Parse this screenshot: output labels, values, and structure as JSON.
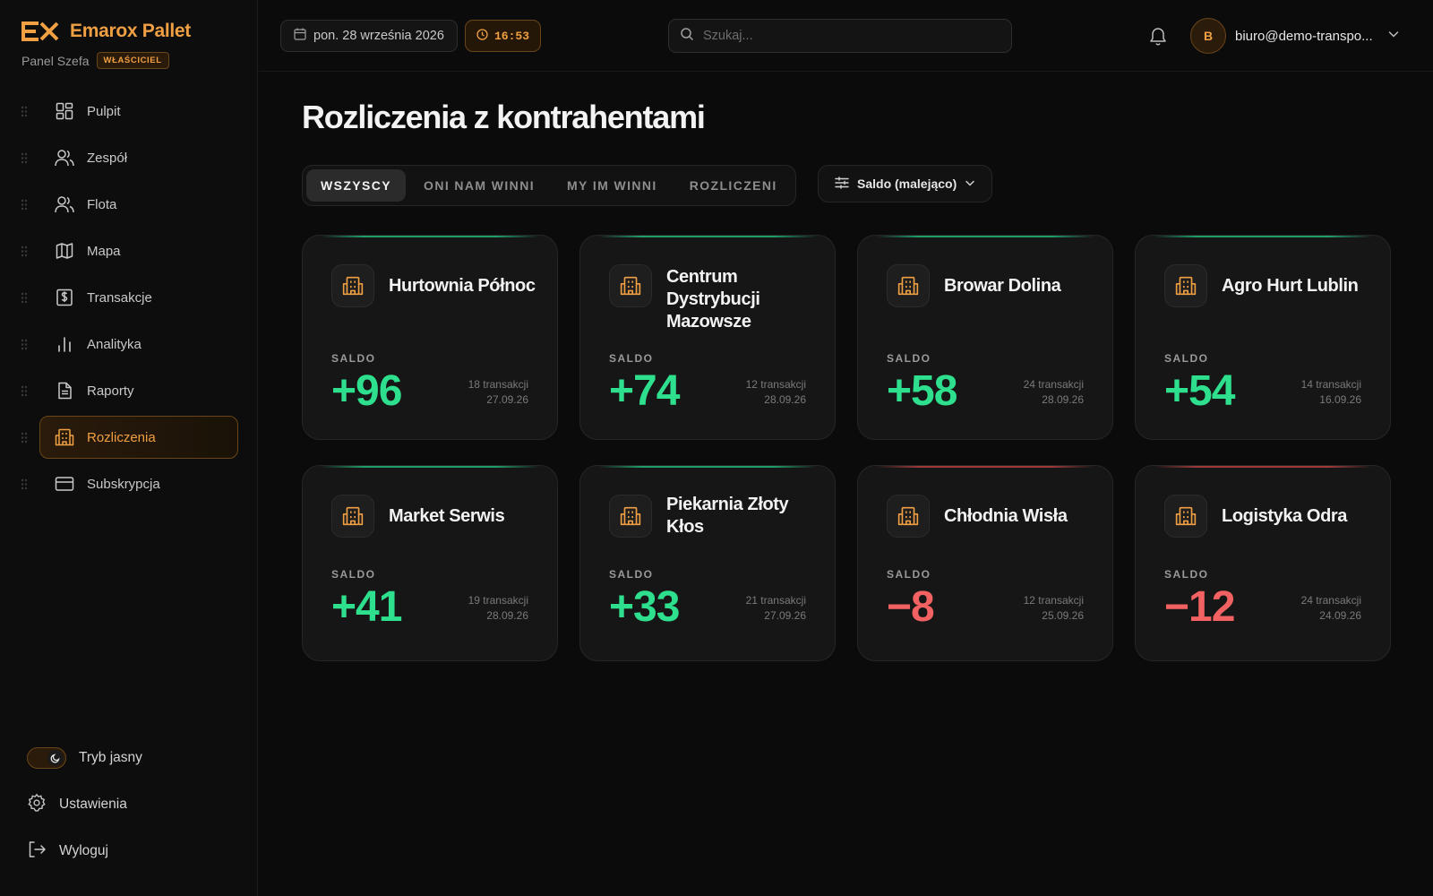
{
  "brand": {
    "name": "Emarox Pallet",
    "subtitle": "Panel Szefa",
    "role": "WŁAŚCICIEL",
    "accent": "#f0a043"
  },
  "sidebar": {
    "items": [
      {
        "label": "Pulpit",
        "icon": "dashboard-icon"
      },
      {
        "label": "Zespół",
        "icon": "users-icon"
      },
      {
        "label": "Flota",
        "icon": "users-icon"
      },
      {
        "label": "Mapa",
        "icon": "map-icon"
      },
      {
        "label": "Transakcje",
        "icon": "dollar-receipt-icon"
      },
      {
        "label": "Analityka",
        "icon": "bar-chart-icon"
      },
      {
        "label": "Raporty",
        "icon": "document-icon"
      },
      {
        "label": "Rozliczenia",
        "icon": "building-icon",
        "active": true
      },
      {
        "label": "Subskrypcja",
        "icon": "credit-card-icon"
      }
    ],
    "bottom": {
      "theme_label": "Tryb jasny",
      "settings_label": "Ustawienia",
      "logout_label": "Wyloguj"
    }
  },
  "topbar": {
    "date": "pon. 28 września 2026",
    "time": "16:53",
    "search_placeholder": "Szukaj...",
    "user_initial": "B",
    "user_email": "biuro@demo-transpo..."
  },
  "page": {
    "title": "Rozliczenia z kontrahentami",
    "tabs": [
      "WSZYSCY",
      "ONI NAM WINNI",
      "MY IM WINNI",
      "ROZLICZENI"
    ],
    "active_tab": "WSZYSCY",
    "sort_label": "Saldo (malejąco)"
  },
  "cards": [
    {
      "name": "Hurtownia Północ",
      "label": "SALDO",
      "value": "+96",
      "transactions": "18 transakcji",
      "date": "27.09.26",
      "sign": "pos"
    },
    {
      "name": "Centrum Dystrybucji Mazowsze",
      "label": "SALDO",
      "value": "+74",
      "transactions": "12 transakcji",
      "date": "28.09.26",
      "sign": "pos"
    },
    {
      "name": "Browar Dolina",
      "label": "SALDO",
      "value": "+58",
      "transactions": "24 transakcji",
      "date": "28.09.26",
      "sign": "pos"
    },
    {
      "name": "Agro Hurt Lublin",
      "label": "SALDO",
      "value": "+54",
      "transactions": "14 transakcji",
      "date": "16.09.26",
      "sign": "pos"
    },
    {
      "name": "Market Serwis",
      "label": "SALDO",
      "value": "+41",
      "transactions": "19 transakcji",
      "date": "28.09.26",
      "sign": "pos"
    },
    {
      "name": "Piekarnia Złoty Kłos",
      "label": "SALDO",
      "value": "+33",
      "transactions": "21 transakcji",
      "date": "27.09.26",
      "sign": "pos"
    },
    {
      "name": "Chłodnia Wisła",
      "label": "SALDO",
      "value": "−8",
      "transactions": "12 transakcji",
      "date": "25.09.26",
      "sign": "neg"
    },
    {
      "name": "Logistyka Odra",
      "label": "SALDO",
      "value": "−12",
      "transactions": "24 transakcji",
      "date": "24.09.26",
      "sign": "neg"
    }
  ],
  "colors": {
    "positive": "#2ee08e",
    "negative": "#f26262",
    "background": "#0b0b0b",
    "card": "#161616"
  }
}
